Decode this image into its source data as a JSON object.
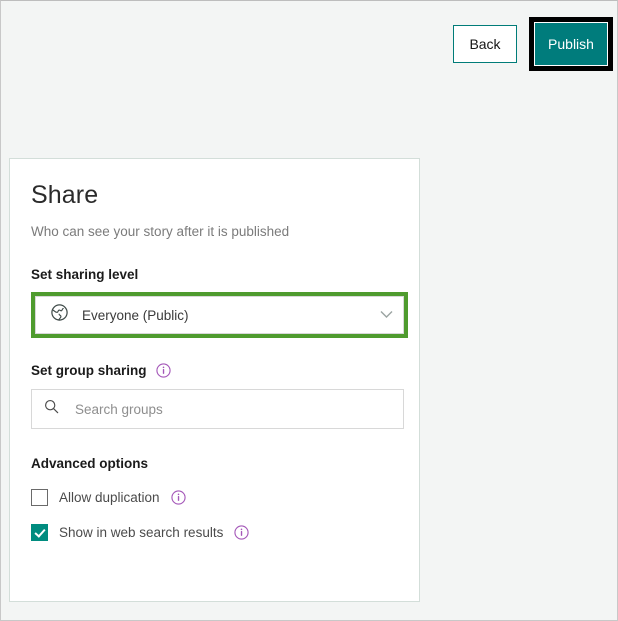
{
  "toolbar": {
    "back_label": "Back",
    "publish_label": "Publish"
  },
  "share_panel": {
    "title": "Share",
    "subtitle": "Who can see your story after it is published",
    "sharing_level": {
      "label": "Set sharing level",
      "selected": "Everyone (Public)",
      "icon": "globe-icon",
      "chevron": "chevron-down-icon"
    },
    "group_sharing": {
      "label": "Set group sharing",
      "info": "info-icon",
      "search_placeholder": "Search groups",
      "search_value": "",
      "search_icon": "search-icon"
    },
    "advanced": {
      "label": "Advanced options",
      "options": [
        {
          "label": "Allow duplication",
          "checked": false,
          "info": "info-icon"
        },
        {
          "label": "Show in web search results",
          "checked": true,
          "info": "info-icon"
        }
      ]
    }
  },
  "colors": {
    "accent_teal": "#007c7c",
    "checkbox_teal": "#008c7f",
    "focus_green": "#4f9b2e",
    "info_purple": "#a457b8",
    "page_bg": "#f3f5f4"
  }
}
